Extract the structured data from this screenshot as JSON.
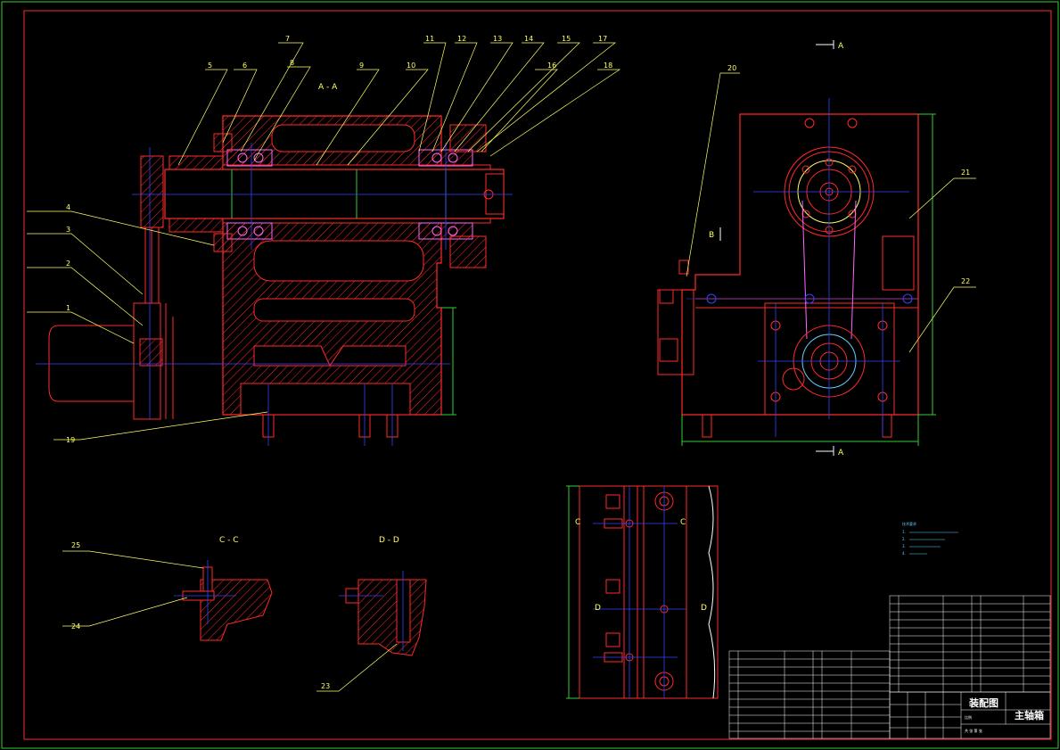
{
  "views": {
    "section_aa": "A - A",
    "section_cc": "C - C",
    "section_dd": "D - D",
    "arrow_a_top": "A",
    "arrow_a_bottom": "A",
    "arrow_b": "B",
    "arrow_c_left": "C",
    "arrow_c_right": "C",
    "arrow_d_left": "D",
    "arrow_d_right": "D"
  },
  "balloons": [
    "1",
    "2",
    "3",
    "4",
    "5",
    "6",
    "7",
    "8",
    "9",
    "10",
    "11",
    "12",
    "13",
    "14",
    "15",
    "16",
    "17",
    "18",
    "19",
    "20",
    "21",
    "22",
    "23",
    "24",
    "25"
  ],
  "notes": {
    "heading": "技术要求",
    "lines": [
      "1.",
      "2.",
      "3.",
      "4."
    ]
  },
  "title_block": {
    "drawing_name": "装配图",
    "part_name": "主轴箱",
    "scale_label": "比例",
    "sheet_label": "共 张 第 张"
  },
  "colors": {
    "border": "#33cc33",
    "outline": "#ff2a2a",
    "centerline": "#3344ff",
    "leader": "#ffff66",
    "hatch": "#ff2a2a",
    "dimension": "#33cc33",
    "bearing": "#ff66ff",
    "seal": "#00cccc"
  }
}
